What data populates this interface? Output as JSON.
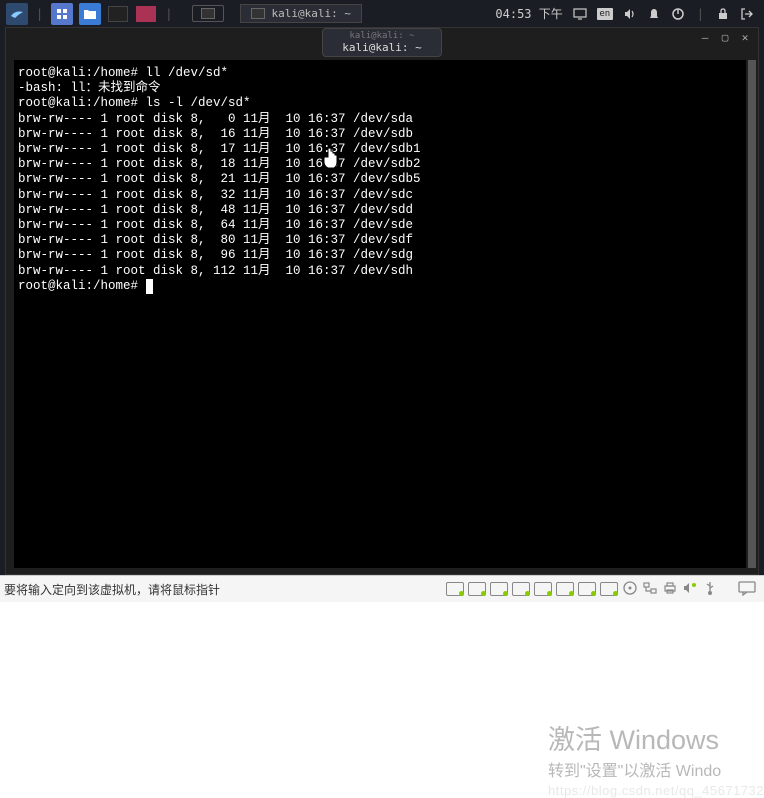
{
  "panel": {
    "clock": "04:53 下午",
    "task_active": "kali@kali: ~"
  },
  "window": {
    "title_small": "kali@kali: ~",
    "title_main": "kali@kali: ~"
  },
  "terminal": {
    "prompt1": "root@kali:/home#",
    "cmd1": " ll /dev/sd*",
    "err1": "-bash: ll：未找到命令",
    "prompt2": "root@kali:/home#",
    "cmd2": " ls -l /dev/sd*",
    "listing": [
      "brw-rw---- 1 root disk 8,   0 11月  10 16:37 /dev/sda",
      "brw-rw---- 1 root disk 8,  16 11月  10 16:37 /dev/sdb",
      "brw-rw---- 1 root disk 8,  17 11月  10 16:37 /dev/sdb1",
      "brw-rw---- 1 root disk 8,  18 11月  10 16:37 /dev/sdb2",
      "brw-rw---- 1 root disk 8,  21 11月  10 16:37 /dev/sdb5",
      "brw-rw---- 1 root disk 8,  32 11月  10 16:37 /dev/sdc",
      "brw-rw---- 1 root disk 8,  48 11月  10 16:37 /dev/sdd",
      "brw-rw---- 1 root disk 8,  64 11月  10 16:37 /dev/sde",
      "brw-rw---- 1 root disk 8,  80 11月  10 16:37 /dev/sdf",
      "brw-rw---- 1 root disk 8,  96 11月  10 16:37 /dev/sdg",
      "brw-rw---- 1 root disk 8, 112 11月  10 16:37 /dev/sdh"
    ],
    "prompt3": "root@kali:/home#",
    "cursor": " "
  },
  "vm_status": {
    "text": "要将输入定向到该虚拟机，请将鼠标指针"
  },
  "watermark": {
    "title": "激活 Windows",
    "sub": "转到\"设置\"以激活 Windo",
    "url": "https://blog.csdn.net/qq_45671732"
  }
}
